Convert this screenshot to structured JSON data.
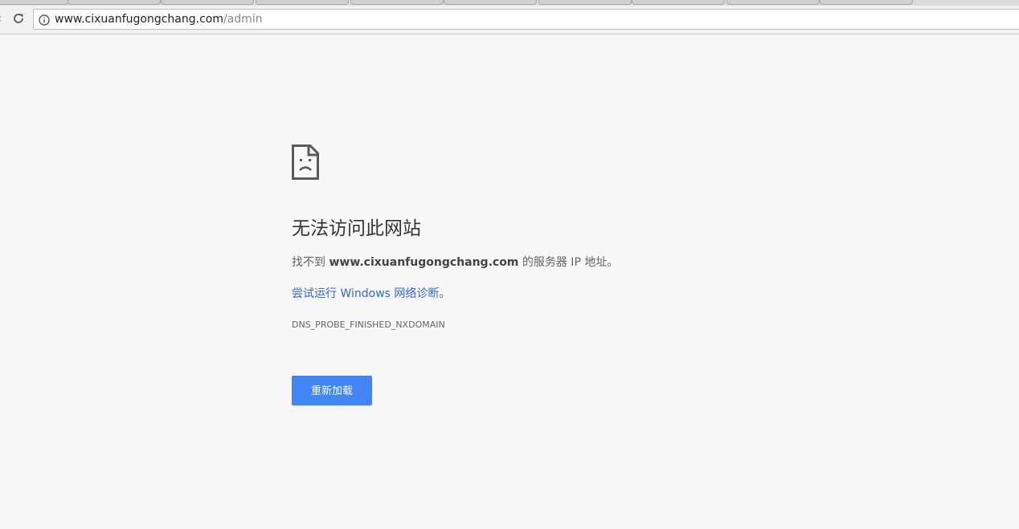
{
  "browser": {
    "url_host": "www.cixuanfugongchang.com",
    "url_path": "/admin",
    "back_symbol": "‹"
  },
  "error": {
    "title": "无法访问此网站",
    "message_prefix": "找不到",
    "message_domain": "www.cixuanfugongchang.com",
    "message_suffix": "的服务器 IP 地址。",
    "diagnose_link": "尝试运行 Windows 网络诊断",
    "diagnose_suffix": "。",
    "error_code": "DNS_PROBE_FINISHED_NXDOMAIN",
    "reload_label": "重新加载"
  },
  "colors": {
    "accent": "#4285f4",
    "link": "#3367d6",
    "background": "#f7f7f7"
  },
  "icons": {
    "reload": "reload-icon",
    "info": "info-icon",
    "error": "sad-page-icon"
  }
}
